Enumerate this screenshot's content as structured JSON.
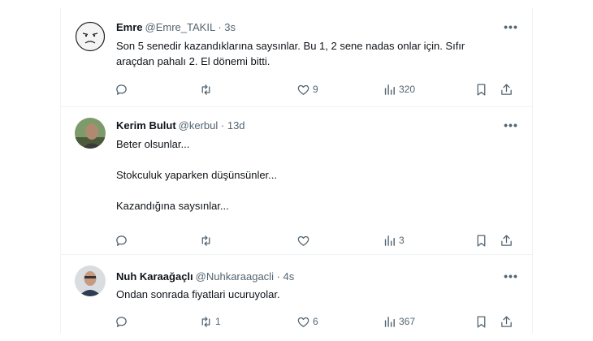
{
  "tweets": [
    {
      "name": "Emre",
      "handle": "@Emre_TAKIL",
      "time": "· 3s",
      "lines": [
        "Son 5 senedir kazandıklarına saysınlar. Bu 1, 2 sene nadas onlar için. Sıfır",
        "araçdan pahalı 2. El dönemi bitti."
      ],
      "reply_count": "",
      "retweet_count": "",
      "like_count": "9",
      "view_count": "320"
    },
    {
      "name": "Kerim Bulut",
      "handle": "@kerbul",
      "time": "· 13d",
      "lines": [
        "Beter olsunlar...",
        "",
        "Stokculuk yaparken düşünsünler...",
        "",
        "Kazandığına saysınlar..."
      ],
      "reply_count": "",
      "retweet_count": "",
      "like_count": "",
      "view_count": "3"
    },
    {
      "name": "Nuh Karaağaçlı",
      "handle": "@Nuhkaraagacli",
      "time": "· 4s",
      "lines": [
        "Ondan sonrada fiyatlari ucuruyolar."
      ],
      "reply_count": "",
      "retweet_count": "1",
      "like_count": "6",
      "view_count": "367"
    }
  ],
  "more_label": "•••",
  "icons": {
    "reply": "reply-icon",
    "retweet": "retweet-icon",
    "like": "like-icon",
    "views": "views-icon",
    "bookmark": "bookmark-icon",
    "share": "share-icon"
  },
  "colors": {
    "text_primary": "#0f1419",
    "text_secondary": "#536471",
    "divider": "#eff3f4"
  }
}
